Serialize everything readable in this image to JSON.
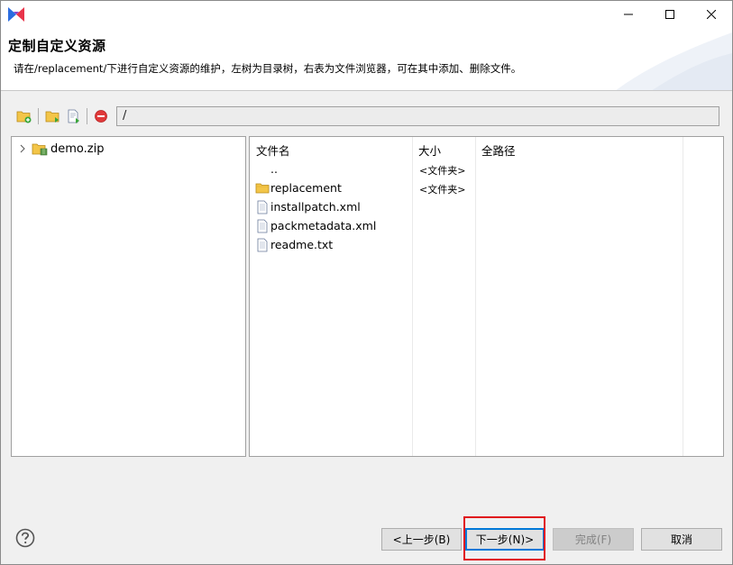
{
  "window": {
    "logo_icon": "app-logo-icon",
    "controls": [
      "minimize-icon",
      "maximize-icon",
      "close-icon"
    ]
  },
  "header": {
    "title": "定制自定义资源",
    "description": "请在/replacement/下进行自定义资源的维护，左树为目录树，右表为文件浏览器，可在其中添加、删除文件。"
  },
  "toolbar": {
    "icons": [
      "new-folder-icon",
      "add-folder-icon",
      "add-file-icon",
      "delete-icon"
    ],
    "path_value": "/"
  },
  "tree": {
    "items": [
      {
        "label": "demo.zip",
        "icon": "zip-folder-icon",
        "expandable": true
      }
    ]
  },
  "file_table": {
    "columns": [
      "文件名",
      "大小",
      "全路径"
    ],
    "rows": [
      {
        "name": "..",
        "size": "<文件夹>",
        "icon": "none",
        "path": ""
      },
      {
        "name": "replacement",
        "size": "<文件夹>",
        "icon": "folder-icon",
        "path": ""
      },
      {
        "name": "installpatch.xml",
        "size": "",
        "icon": "file-icon",
        "path": ""
      },
      {
        "name": "packmetadata.xml",
        "size": "",
        "icon": "file-icon",
        "path": ""
      },
      {
        "name": "readme.txt",
        "size": "",
        "icon": "file-icon",
        "path": ""
      }
    ]
  },
  "footer": {
    "help_icon": "help-icon",
    "back_label": "<上一步(B)",
    "next_label": "下一步(N)>",
    "finish_label": "完成(F)",
    "cancel_label": "取消"
  },
  "colors": {
    "accent": "#0078d7",
    "highlight": "#e0121a",
    "folder": "#f3c548"
  }
}
